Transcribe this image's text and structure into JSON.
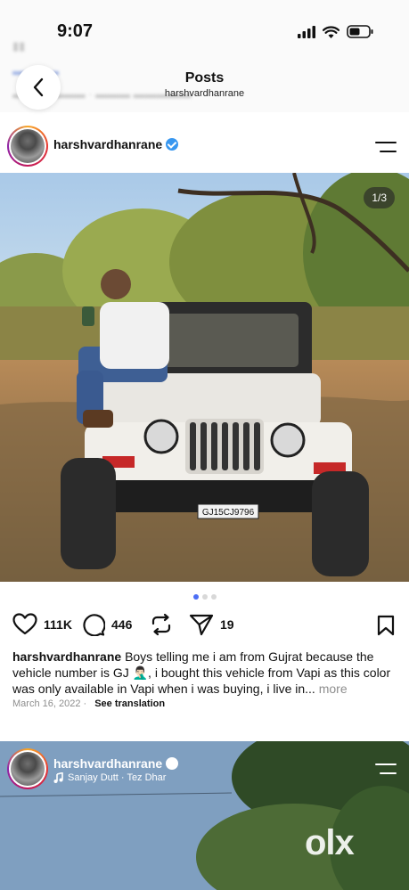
{
  "status_bar": {
    "time": "9:07",
    "icons": [
      "signal-icon",
      "wifi-icon",
      "battery-icon"
    ]
  },
  "header": {
    "title": "Posts",
    "subtitle": "harshvardhanrane",
    "back_icon": "chevron-left-icon"
  },
  "post": {
    "username": "harshvardhanrane",
    "verified": true,
    "image_counter": "1/3",
    "carousel_count": 3,
    "carousel_active": 1,
    "likes": "111K",
    "comments": "446",
    "shares": "19",
    "caption_user": "harshvardhanrane",
    "caption_text": "Boys telling me i am from Gujrat  because the vehicle number is GJ 🤦🏻‍♂️, i bought this vehicle from Vapi as this color was only available in Vapi when i was buying, i live in...",
    "caption_more": "more",
    "date": "March 16, 2022",
    "see_translation": "See translation",
    "license_plate": "GJ15CJ9796"
  },
  "next_post": {
    "username": "harshvardhanrane",
    "verified": true,
    "music": "Sanjay Dutt · Tez Dhar"
  },
  "watermark": "OLX",
  "colors": {
    "verified_blue": "#3897f0",
    "carousel_active": "#4c6ef5",
    "muted_text": "#8e8e8e"
  }
}
